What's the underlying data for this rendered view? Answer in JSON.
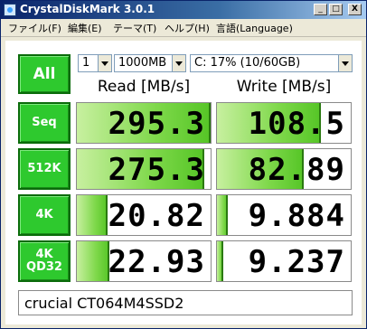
{
  "window": {
    "title": "CrystalDiskMark 3.0.1",
    "controls": {
      "minimize": "_",
      "maximize": "□",
      "close": "X"
    }
  },
  "menu": {
    "file": "ファイル(F)",
    "edit": "編集(E)",
    "theme": "テーマ(T)",
    "help": "ヘルプ(H)",
    "language": "言語(Language)"
  },
  "toolbar": {
    "all_button": "All",
    "passes": "1",
    "size": "1000MB",
    "drive": "C: 17% (10/60GB)"
  },
  "headers": {
    "read": "Read [MB/s]",
    "write": "Write [MB/s]"
  },
  "tests": [
    {
      "label": "Seq",
      "read": "295.3",
      "write": "108.5"
    },
    {
      "label": "512K",
      "read": "275.3",
      "write": "82.89"
    },
    {
      "label": "4K",
      "read": "20.82",
      "write": "9.884"
    },
    {
      "label_line1": "4K",
      "label_line2": "QD32",
      "read": "22.93",
      "write": "9.237"
    }
  ],
  "drive_name": "crucial CT064M4SSD2",
  "bar_fill": {
    "read": [
      1.0,
      0.95,
      0.23,
      0.24
    ],
    "write": [
      0.78,
      0.65,
      0.08,
      0.05
    ]
  },
  "colors": {
    "button_green": "#2ec92e",
    "bar_green": "#55c526",
    "title_blue": "#0a246a"
  }
}
